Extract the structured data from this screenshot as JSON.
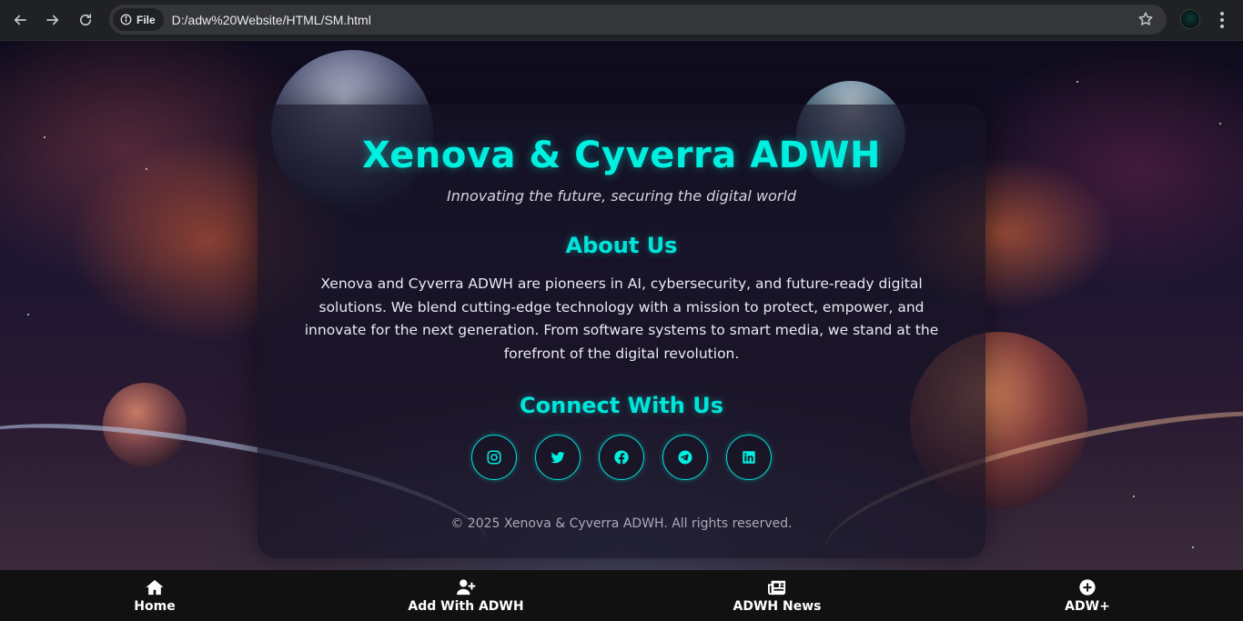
{
  "browser": {
    "site_chip_label": "File",
    "url": "D:/adw%20Website/HTML/SM.html",
    "icons": [
      "back-arrow-icon",
      "forward-arrow-icon",
      "reload-icon",
      "info-icon",
      "star-icon",
      "profile-avatar",
      "more-vert-icon"
    ]
  },
  "page": {
    "title": "Xenova & Cyverra ADWH",
    "tagline": "Innovating the future, securing the digital world",
    "about": {
      "heading": "About Us",
      "text": "Xenova and Cyverra ADWH are pioneers in AI, cybersecurity, and future-ready digital solutions. We blend cutting-edge technology with a mission to protect, empower, and innovate for the next generation. From software systems to smart media, we stand at the forefront of the digital revolution."
    },
    "connect": {
      "heading": "Connect With Us",
      "socials": [
        "instagram",
        "twitter",
        "facebook",
        "telegram",
        "linkedin"
      ]
    },
    "copyright": "© 2025 Xenova & Cyverra ADWH. All rights reserved."
  },
  "bottom_nav": {
    "items": [
      {
        "label": "Home",
        "icon": "home-icon"
      },
      {
        "label": "Add With ADWH",
        "icon": "user-plus-icon"
      },
      {
        "label": "ADWH News",
        "icon": "newspaper-icon"
      },
      {
        "label": "ADW+",
        "icon": "plus-circle-icon"
      }
    ]
  },
  "colors": {
    "accent": "#00f0e0",
    "chrome_bg": "#202124",
    "omnibox_bg": "#35363a",
    "nav_bg": "#111111"
  }
}
